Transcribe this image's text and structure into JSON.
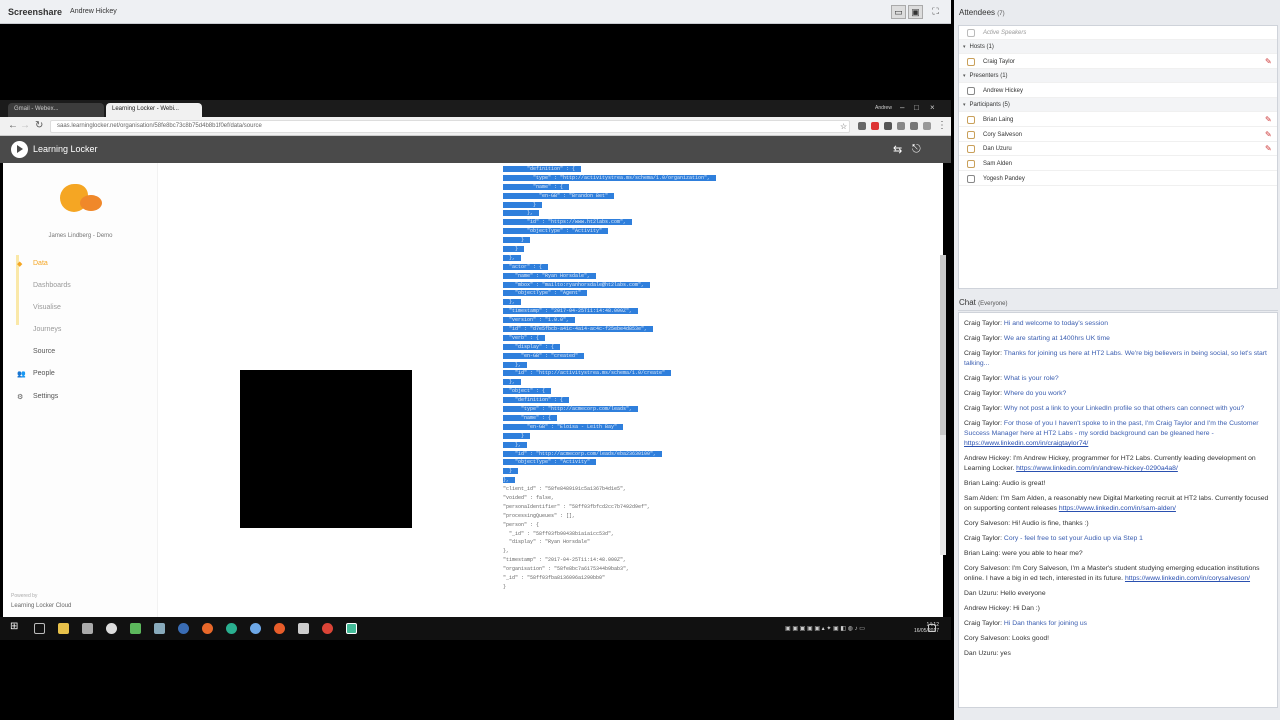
{
  "screenshare": {
    "title": "Screenshare",
    "presenter": "Andrew Hickey"
  },
  "browser": {
    "tabs": [
      "Gmail - Webex...",
      "Learning Locker - Webi..."
    ],
    "window_user": "Andrew",
    "url": "saas.learninglocker.net/organisation/58fe8bc73c8b75d4b8b1f0ef/data/source"
  },
  "ll": {
    "app_name": "Learning Locker",
    "user": "James Lindberg - Demo",
    "nav": [
      "Data",
      "Dashboards",
      "Visualise",
      "Journeys",
      "Source",
      "People",
      "Settings"
    ],
    "powered": "Powered by",
    "powered_by": "Learning Locker Cloud"
  },
  "json_lines": [
    "        \"definition\" : {",
    "          \"type\" : \"http://activitystrea.ms/schema/1.0/organization\",",
    "          \"name\" : {",
    "            \"en-GB\" : \"Brandon Bet\"",
    "          }",
    "        },",
    "        \"id\" : \"https://www.ht2labs.com\",",
    "        \"objectType\" : \"Activity\"",
    "      }",
    "    }",
    "  },",
    "  \"actor\" : {",
    "    \"name\" : \"Ryan Horsdale\",",
    "    \"mbox\" : \"mailto:ryanhorsdale@ht2labs.com\",",
    "    \"objectType\" : \"Agent\"",
    "  },",
    "  \"timestamp\" : \"2017-04-25T11:14:48.000Z\",",
    "  \"version\" : \"1.0.0\",",
    "  \"id\" : \"d7e5fbcb-a41c-4a14-ac4c-f25ebe4d853e\",",
    "  \"verb\" : {",
    "    \"display\" : {",
    "      \"en-GB\" : \"created\"",
    "    },",
    "    \"id\" : \"http://activitystrea.ms/schema/1.0/create\"",
    "  },",
    "  \"object\" : {",
    "    \"definition\" : {",
    "      \"type\" : \"http://acmecorp.com/leads\",",
    "      \"name\" : {",
    "        \"en-GB\" : \"Eloisa - Leith Bay\"",
    "      }",
    "    },",
    "    \"id\" : \"http://acmecorp.com/leads/eba23630100\",",
    "    \"objectType\" : \"Activity\"",
    "  }",
    "},",
    "\"client_id\" : \"58fe8489191c5a1367b4d1e5\",",
    "\"voided\" : false,",
    "\"personaIdentifier\" : \"58ff03fbfcd2cc7b7492d9ef\",",
    "\"processingQueues\" : [],",
    "\"person\" : {",
    "  \"_id\" : \"58ff03fb90438b1a1a1cc53d\",",
    "  \"display\" : \"Ryan Horsdale\"",
    "},",
    "\"timestamp\" : \"2017-04-25T11:14:48.000Z\",",
    "\"organisation\" : \"58fe8bc7a6175344b9bab3\",",
    "\"_id\" : \"58ff03fba8136096a1290bb0\"",
    "}"
  ],
  "json_selected_lines": 36,
  "attendees": {
    "title": "Attendees",
    "count": "(7)",
    "active_speakers": "Active Speakers",
    "hosts_label": "Hosts (1)",
    "hosts": [
      "Craig Taylor"
    ],
    "presenters_label": "Presenters (1)",
    "presenters": [
      "Andrew Hickey"
    ],
    "participants_label": "Participants (5)",
    "participants": [
      "Brian Laing",
      "Cory Salveson",
      "Dan Uzuru",
      "Sam Alden",
      "Yogesh Pandey"
    ]
  },
  "chat": {
    "title": "Chat",
    "scope": "(Everyone)",
    "messages": [
      {
        "from": "Craig Taylor:",
        "text": "Hi and welcome to today's session",
        "blue": true
      },
      {
        "from": "Craig Taylor:",
        "text": "We are starting at 1400hrs UK time",
        "blue": true
      },
      {
        "from": "Craig Taylor:",
        "text": "Thanks for joining us here at HT2 Labs. We're big believers in being social, so let's start talking...",
        "blue": true
      },
      {
        "from": "Craig Taylor:",
        "text": "What is your role?",
        "blue": true
      },
      {
        "from": "Craig Taylor:",
        "text": "Where do you work?",
        "blue": true
      },
      {
        "from": "Craig Taylor:",
        "text": "Why not post a link to your LinkedIn profile so that others can connect with you?",
        "blue": true
      },
      {
        "from": "Craig Taylor:",
        "text": "For those of you I haven't spoke to in the past, I'm Craig Taylor and I'm the Customer Success Manager here at HT2 Labs - my sordid background can be gleaned here -",
        "link": "https://www.linkedin.com/in/craigtaylor74/",
        "blue": true
      },
      {
        "from": "Andrew Hickey:",
        "text": "I'm Andrew Hickey, programmer for HT2 Labs. Currently leading development on Learning Locker.",
        "link": "https://www.linkedin.com/in/andrew-hickey-0290a4a8/",
        "blue": false
      },
      {
        "from": "Brian Laing:",
        "text": "Audio is great!",
        "blue": false
      },
      {
        "from": "Sam Alden:",
        "text": "I'm Sam Alden, a reasonably new Digital Marketing recruit at HT2 labs. Currently focused on supporting content releases",
        "link": "https://www.linkedin.com/in/sam-alden/",
        "blue": false
      },
      {
        "from": "Cory Salveson:",
        "text": "Hi! Audio is fine, thanks :)",
        "blue": false
      },
      {
        "from": "Craig Taylor:",
        "text": "Cory - feel free to set your Audio up via Step 1",
        "blue": true
      },
      {
        "from": "Brian Laing:",
        "text": "were you able to hear me?",
        "blue": false
      },
      {
        "from": "Cory Salveson:",
        "text": "I'm Cory Salveson, I'm a Master's student studying emerging education institutions online. I have a big in ed tech, interested in its future.",
        "link": "https://www.linkedin.com/in/corysalveson/",
        "blue": false
      },
      {
        "from": "Dan Uzuru:",
        "text": "Hello everyone",
        "blue": false
      },
      {
        "from": "Andrew Hickey:",
        "text": "Hi Dan :)",
        "blue": false
      },
      {
        "from": "Craig Taylor:",
        "text": "Hi Dan thanks for joining us",
        "blue": true
      },
      {
        "from": "Cory Salveson:",
        "text": "Looks good!",
        "blue": false
      },
      {
        "from": "Dan Uzuru:",
        "text": "yes",
        "blue": false
      }
    ]
  },
  "taskbar": {
    "time": "14:12",
    "date": "16/05/2017"
  },
  "colors": {
    "selection": "#2f7fdc",
    "chat_blue": "#3a5db0",
    "header": "#4a4a4a",
    "accent": "#f5a623"
  }
}
